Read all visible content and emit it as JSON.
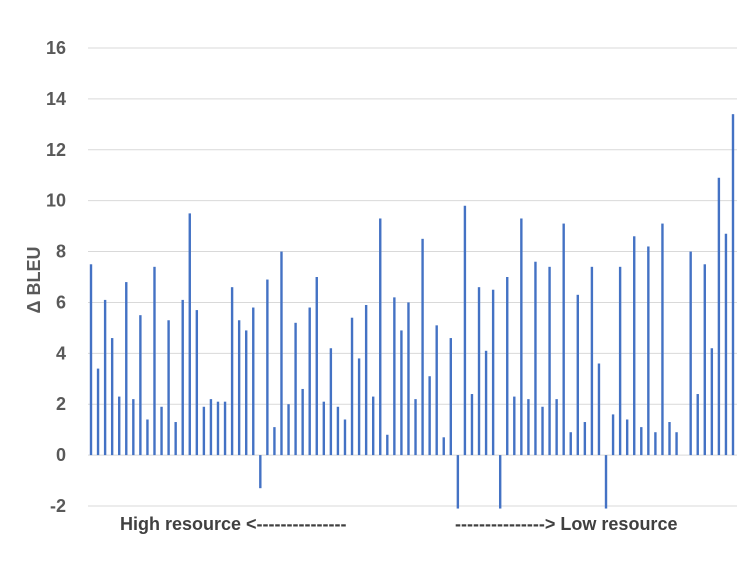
{
  "chart_data": {
    "type": "bar",
    "ylabel": "Δ BLEU",
    "ylim": [
      -2,
      16
    ],
    "yticks": [
      -2,
      0,
      2,
      4,
      6,
      8,
      10,
      12,
      14,
      16
    ],
    "grid": true,
    "bar_color": "#4472C4",
    "annotations": {
      "left": "High resource <---------------",
      "right": "---------------> Low resource"
    },
    "values": [
      7.5,
      3.4,
      6.1,
      4.6,
      2.3,
      6.8,
      2.2,
      5.5,
      1.4,
      7.4,
      1.9,
      5.3,
      1.3,
      6.1,
      9.5,
      5.7,
      1.9,
      2.2,
      2.1,
      2.1,
      6.6,
      5.3,
      4.9,
      5.8,
      -1.3,
      6.9,
      1.1,
      8.0,
      2.0,
      5.2,
      2.6,
      5.8,
      7.0,
      2.1,
      4.2,
      1.9,
      1.4,
      5.4,
      3.8,
      5.9,
      2.3,
      9.3,
      0.8,
      6.2,
      4.9,
      6.0,
      2.2,
      8.5,
      3.1,
      5.1,
      0.7,
      4.6,
      -2.1,
      9.8,
      2.4,
      6.6,
      4.1,
      6.5,
      -2.1,
      7.0,
      2.3,
      9.3,
      2.2,
      7.6,
      1.9,
      7.4,
      2.2,
      9.1,
      0.9,
      6.3,
      1.3,
      7.4,
      3.6,
      -2.1,
      1.6,
      7.4,
      1.4,
      8.6,
      1.1,
      8.2,
      0.9,
      9.1,
      1.3,
      0.9,
      0,
      8.0,
      2.4,
      7.5,
      4.2,
      10.9,
      8.7,
      13.4
    ]
  }
}
